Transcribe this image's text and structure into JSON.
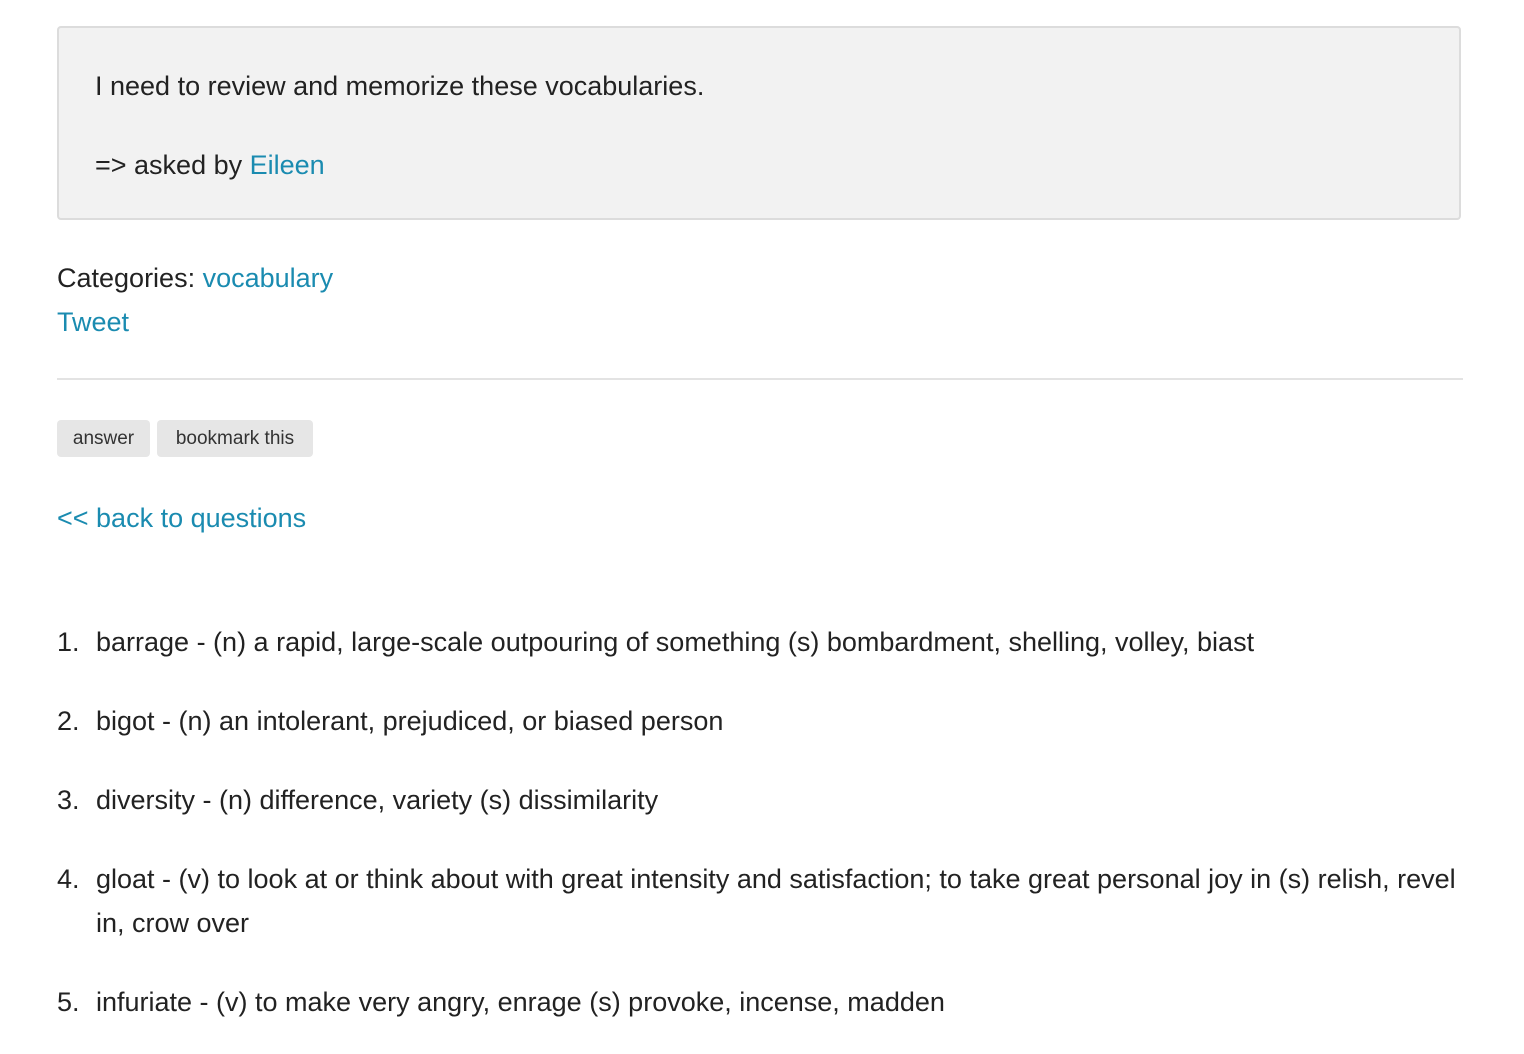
{
  "question": {
    "text": "I need to review and memorize these vocabularies.",
    "asked_prefix": "=> asked by ",
    "asker": "Eileen"
  },
  "categories": {
    "label": "Categories: ",
    "items": [
      "vocabulary"
    ]
  },
  "tweet_label": "Tweet",
  "actions": {
    "answer_label": "answer",
    "bookmark_label": "bookmark this"
  },
  "back_link_label": "<< back to questions",
  "vocabulary": [
    {
      "num": "1.",
      "text": "barrage - (n) a rapid, large-scale outpouring of something (s) bombardment, shelling, volley, biast"
    },
    {
      "num": "2.",
      "text": "bigot - (n) an intolerant, prejudiced, or biased person"
    },
    {
      "num": "3.",
      "text": "diversity - (n) difference, variety (s) dissimilarity"
    },
    {
      "num": "4.",
      "text": "gloat - (v) to look at or think about with great intensity and satisfaction; to take great personal joy in (s) relish, revel in, crow over"
    },
    {
      "num": "5.",
      "text": "infuriate - (v) to make very angry, enrage (s) provoke, incense, madden"
    }
  ]
}
